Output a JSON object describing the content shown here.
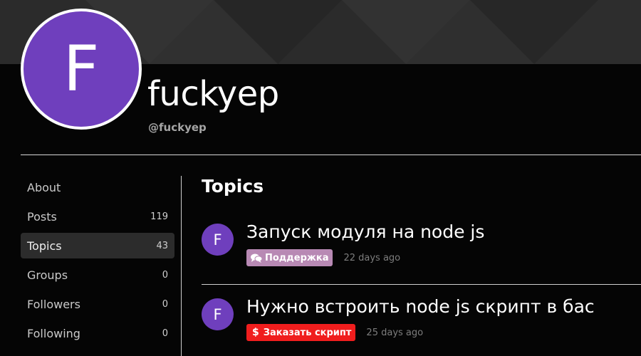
{
  "profile": {
    "avatar_letter": "F",
    "display_name": "fuckyep",
    "username": "@fuckyep"
  },
  "sidebar": {
    "items": [
      {
        "label": "About",
        "count": ""
      },
      {
        "label": "Posts",
        "count": "119"
      },
      {
        "label": "Topics",
        "count": "43"
      },
      {
        "label": "Groups",
        "count": "0"
      },
      {
        "label": "Followers",
        "count": "0"
      },
      {
        "label": "Following",
        "count": "0"
      }
    ]
  },
  "main": {
    "title": "Topics",
    "topics": [
      {
        "avatar_letter": "F",
        "title": "Запуск модуля на node js",
        "category": {
          "label": "Поддержка",
          "color": "#b889b4",
          "icon": "comments-icon"
        },
        "time": "22 days ago"
      },
      {
        "avatar_letter": "F",
        "title": "Нужно встроить node js скрипт в бас",
        "category": {
          "label": "Заказать скрипт",
          "color": "#f01d1d",
          "icon": "dollar-icon"
        },
        "time": "25 days ago"
      }
    ]
  },
  "colors": {
    "avatar_bg": "#6f3fbd",
    "background": "#050505",
    "cover_bg": "#2b2b2b"
  }
}
